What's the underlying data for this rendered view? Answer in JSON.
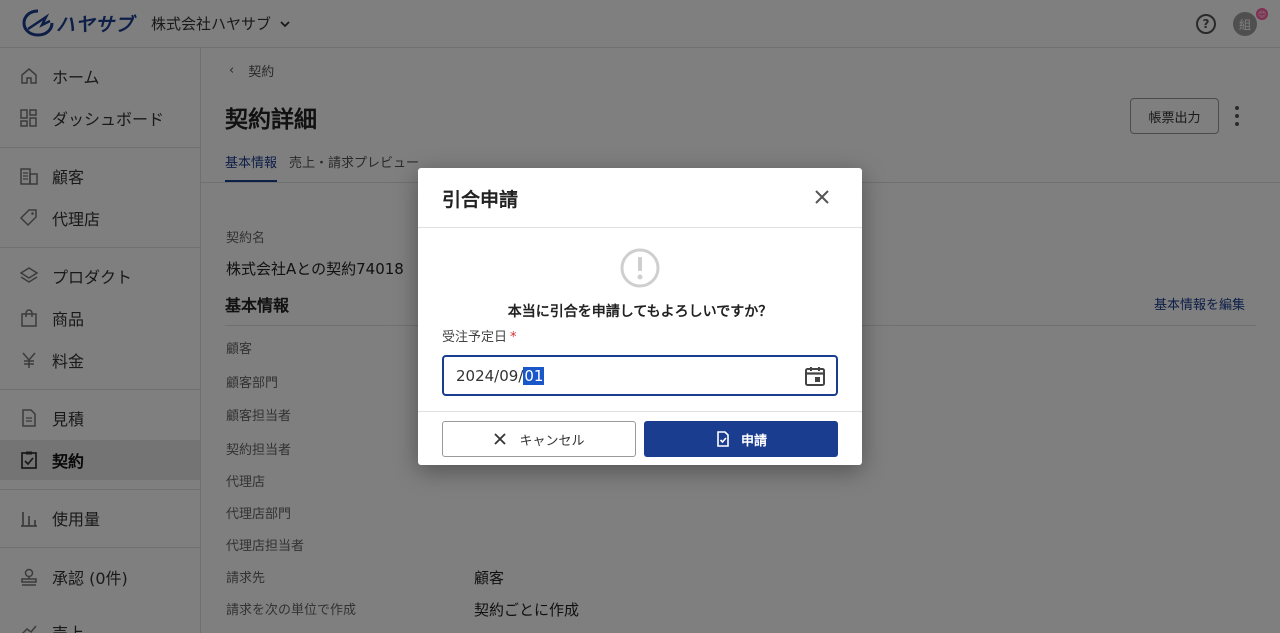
{
  "header": {
    "logo_text": "ハヤサブ",
    "company": "株式会社ハヤサブ",
    "help_symbol": "?",
    "avatar_initial": "組",
    "avatar_badge": "😊"
  },
  "sidebar": {
    "items": [
      {
        "label": "ホーム",
        "icon": "home-icon"
      },
      {
        "label": "ダッシュボード",
        "icon": "dashboard-icon"
      },
      {
        "label": "顧客",
        "icon": "customer-icon"
      },
      {
        "label": "代理店",
        "icon": "agency-icon"
      },
      {
        "label": "プロダクト",
        "icon": "layers-icon"
      },
      {
        "label": "商品",
        "icon": "shopping-bag-icon"
      },
      {
        "label": "料金",
        "icon": "yen-icon"
      },
      {
        "label": "見積",
        "icon": "document-icon"
      },
      {
        "label": "契約",
        "icon": "clipboard-check-icon"
      },
      {
        "label": "使用量",
        "icon": "bar-chart-icon"
      },
      {
        "label": "承認 (0件)",
        "icon": "stamp-icon"
      },
      {
        "label": "売上",
        "icon": "sales-icon"
      }
    ]
  },
  "main": {
    "breadcrumb": "契約",
    "title": "契約詳細",
    "export_button": "帳票出力",
    "tabs": [
      "基本情報",
      "売上・請求プレビュー"
    ],
    "contract_name_label": "契約名",
    "contract_name_value": "株式会社Aとの契約74018",
    "section_title": "基本情報",
    "edit_link": "基本情報を編集",
    "fields": [
      {
        "label": "顧客",
        "value": ""
      },
      {
        "label": "顧客部門",
        "value": ""
      },
      {
        "label": "顧客担当者",
        "value": ""
      },
      {
        "label": "契約担当者",
        "value": ""
      },
      {
        "label": "代理店",
        "value": ""
      },
      {
        "label": "代理店部門",
        "value": ""
      },
      {
        "label": "代理店担当者",
        "value": ""
      },
      {
        "label": "請求先",
        "value": "顧客"
      },
      {
        "label": "請求を次の単位で作成",
        "value": "契約ごとに作成"
      }
    ]
  },
  "dialog": {
    "title": "引合申請",
    "message": "本当に引合を申請してもよろしいですか？",
    "date_label": "受注予定日",
    "required_mark": "*",
    "date_prefix": "2024/09/",
    "date_selected": "01",
    "cancel_label": "キャンセル",
    "submit_label": "申請"
  },
  "colors": {
    "brand": "#1a3d8f",
    "required": "#d32f2f",
    "selection": "#1a57c8"
  }
}
